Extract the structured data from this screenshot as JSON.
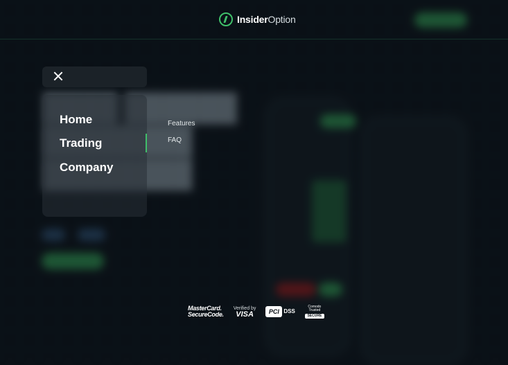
{
  "header": {
    "logo_bold": "Insider",
    "logo_light": "Option"
  },
  "menu": {
    "items": [
      {
        "label": "Home"
      },
      {
        "label": "Trading"
      },
      {
        "label": "Company"
      }
    ],
    "submenu": [
      {
        "label": "Features"
      },
      {
        "label": "FAQ"
      }
    ]
  },
  "payments": {
    "mastercard_line1": "MasterCard.",
    "mastercard_line2": "SecureCode.",
    "visa_line1": "Verified by",
    "visa_line2": "VISA",
    "pci_logo": "PCI",
    "pci_dss": "DSS",
    "comodo_line1": "Comodo",
    "comodo_line2": "Trusted",
    "comodo_badge": "SECURE"
  },
  "colors": {
    "accent": "#3fbf6a",
    "background": "#0b1117"
  }
}
